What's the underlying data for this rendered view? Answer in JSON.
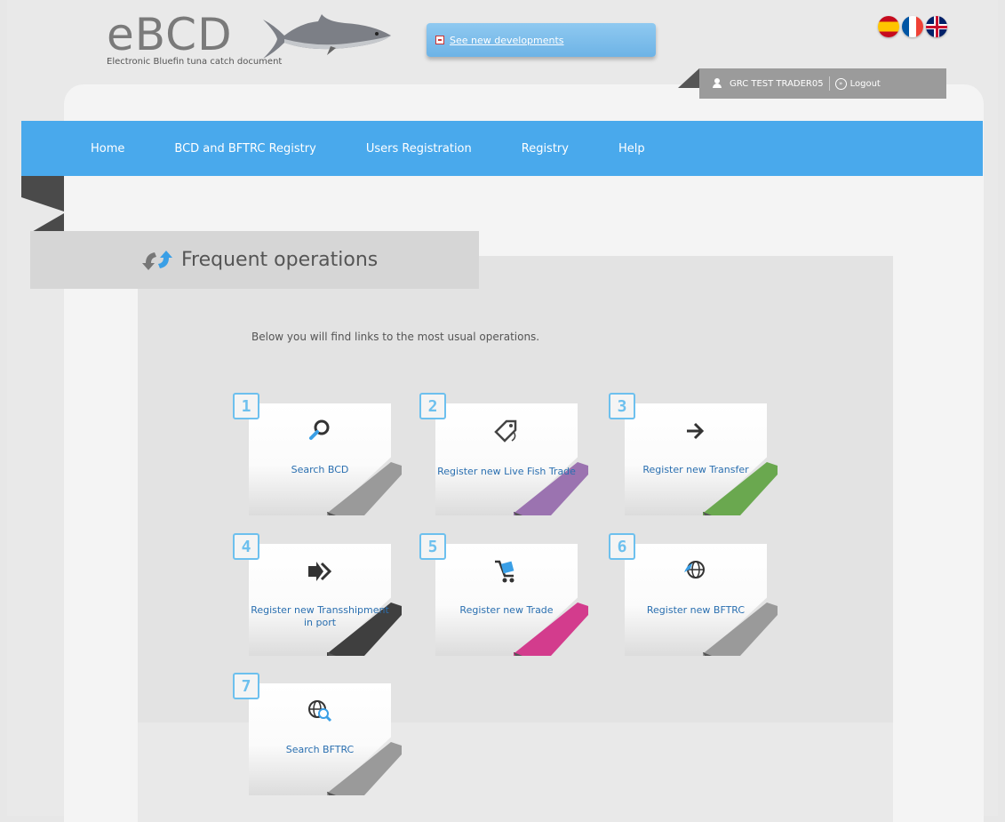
{
  "header": {
    "logo": "eBCD",
    "logo_subtitle": "Electronic Bluefin tuna catch document",
    "news_link": "See new developments",
    "user_name": "GRC TEST TRADER05",
    "logout": "Logout",
    "flags": [
      "es-flag",
      "fr-flag",
      "uk-flag"
    ]
  },
  "nav": {
    "items": [
      "Home",
      "BCD and BFTRC Registry",
      "Users Registration",
      "Registry",
      "Help"
    ]
  },
  "section": {
    "title": "Frequent operations",
    "intro": "Below you will find links to the most usual operations."
  },
  "cards": [
    {
      "number": "1",
      "label": "Search BCD",
      "icon": "search-icon",
      "accent": "#9a9a9a"
    },
    {
      "number": "2",
      "label": "Register new Live Fish Trade",
      "icon": "tag-icon",
      "accent": "#9b73b0"
    },
    {
      "number": "3",
      "label": "Register new Transfer",
      "icon": "arrow-right-icon",
      "accent": "#6aa84f"
    },
    {
      "number": "4",
      "label": "Register new Transshipment in port",
      "icon": "double-arrow-icon",
      "accent": "#3f3f3f"
    },
    {
      "number": "5",
      "label": "Register new Trade",
      "icon": "cart-icon",
      "accent": "#d33c8d"
    },
    {
      "number": "6",
      "label": "Register new BFTRC",
      "icon": "globe-icon",
      "accent": "#9a9a9a"
    },
    {
      "number": "7",
      "label": "Search BFTRC",
      "icon": "globe-search-icon",
      "accent": "#9a9a9a"
    }
  ],
  "colors": {
    "nav": "#49a9ec",
    "number_box": "#6dc0ee",
    "card_label": "#2a6fb0"
  }
}
